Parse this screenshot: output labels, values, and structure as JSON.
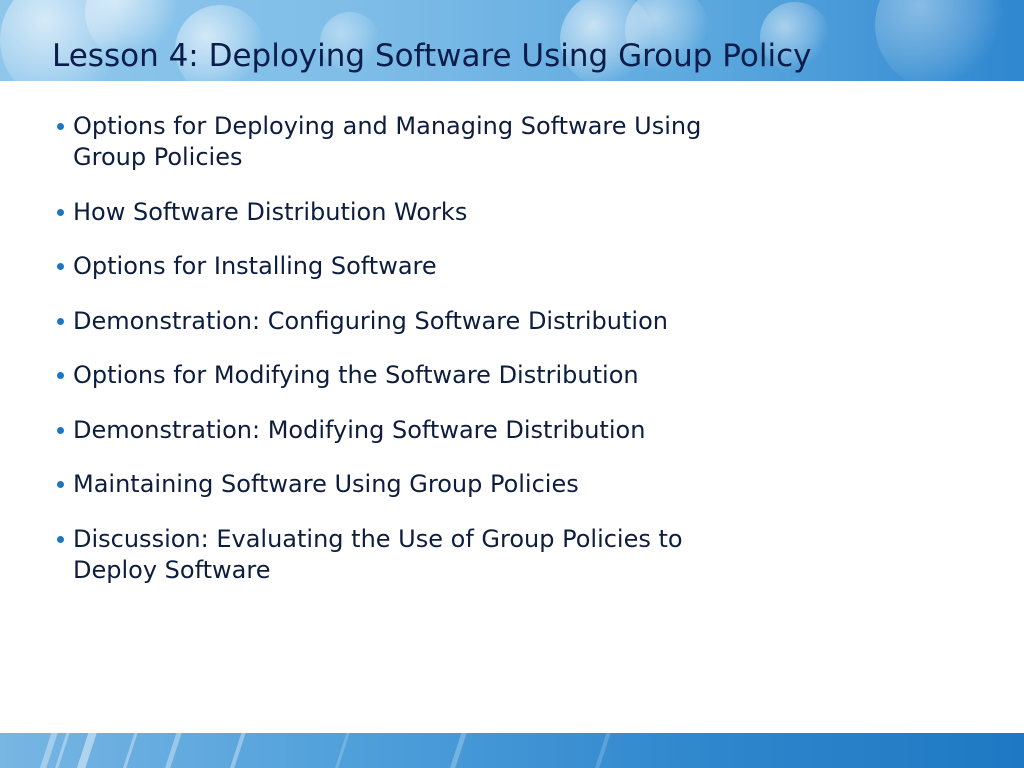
{
  "slide": {
    "title": "Lesson 4: Deploying Software Using Group Policy",
    "bullets": [
      {
        "text": "Options for Deploying and Managing Software Using\nGroup Policies"
      },
      {
        "text": "How Software Distribution Works"
      },
      {
        "text": "Options for Installing Software"
      },
      {
        "text": "Demonstration: Configuring Software Distribution"
      },
      {
        "text": "Options for Modifying the Software Distribution"
      },
      {
        "text": "Demonstration: Modifying Software Distribution"
      },
      {
        "text": "Maintaining Software Using Group Policies"
      },
      {
        "text": "Discussion: Evaluating the Use of Group Policies to\nDeploy Software"
      }
    ]
  },
  "colors": {
    "title_text": "#0b1d4a",
    "body_text": "#0d1d3d",
    "bullet_dot": "#1d76c2",
    "header_band": "#5aa7de",
    "footer_band": "#2e86cc"
  }
}
